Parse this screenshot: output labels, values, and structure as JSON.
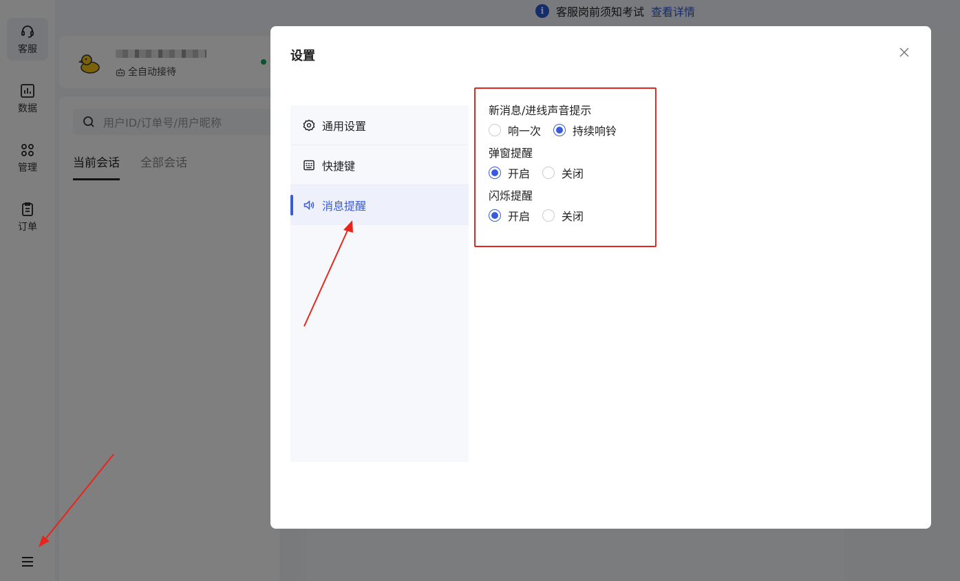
{
  "nav": {
    "items": [
      {
        "label": "客服",
        "icon": "headset-icon"
      },
      {
        "label": "数据",
        "icon": "chart-icon"
      },
      {
        "label": "管理",
        "icon": "grid-icon"
      },
      {
        "label": "订单",
        "icon": "clipboard-icon"
      }
    ],
    "menu_icon": "hamburger-menu-icon"
  },
  "banner": {
    "text": "客服岗前须知考试",
    "link": "查看详情"
  },
  "profile": {
    "status": "全自动接待",
    "online_color": "#19a85d"
  },
  "session_list": {
    "search_placeholder": "用户ID/订单号/用户昵称",
    "tabs": [
      "当前会话",
      "全部会话"
    ],
    "active_tab": "当前会话"
  },
  "dialog": {
    "title": "设置",
    "menu": [
      {
        "label": "通用设置",
        "icon": "gear-icon"
      },
      {
        "label": "快捷键",
        "icon": "keyboard-icon"
      },
      {
        "label": "消息提醒",
        "icon": "speaker-icon"
      }
    ],
    "active_menu": "消息提醒",
    "settings": [
      {
        "label": "新消息/进线声音提示",
        "options": [
          "响一次",
          "持续响铃"
        ],
        "selected": "持续响铃"
      },
      {
        "label": "弹窗提醒",
        "options": [
          "开启",
          "关闭"
        ],
        "selected": "开启"
      },
      {
        "label": "闪烁提醒",
        "options": [
          "开启",
          "关闭"
        ],
        "selected": "开启"
      }
    ]
  },
  "colors": {
    "accent": "#3a5bd9",
    "annotation": "#e8251c"
  }
}
